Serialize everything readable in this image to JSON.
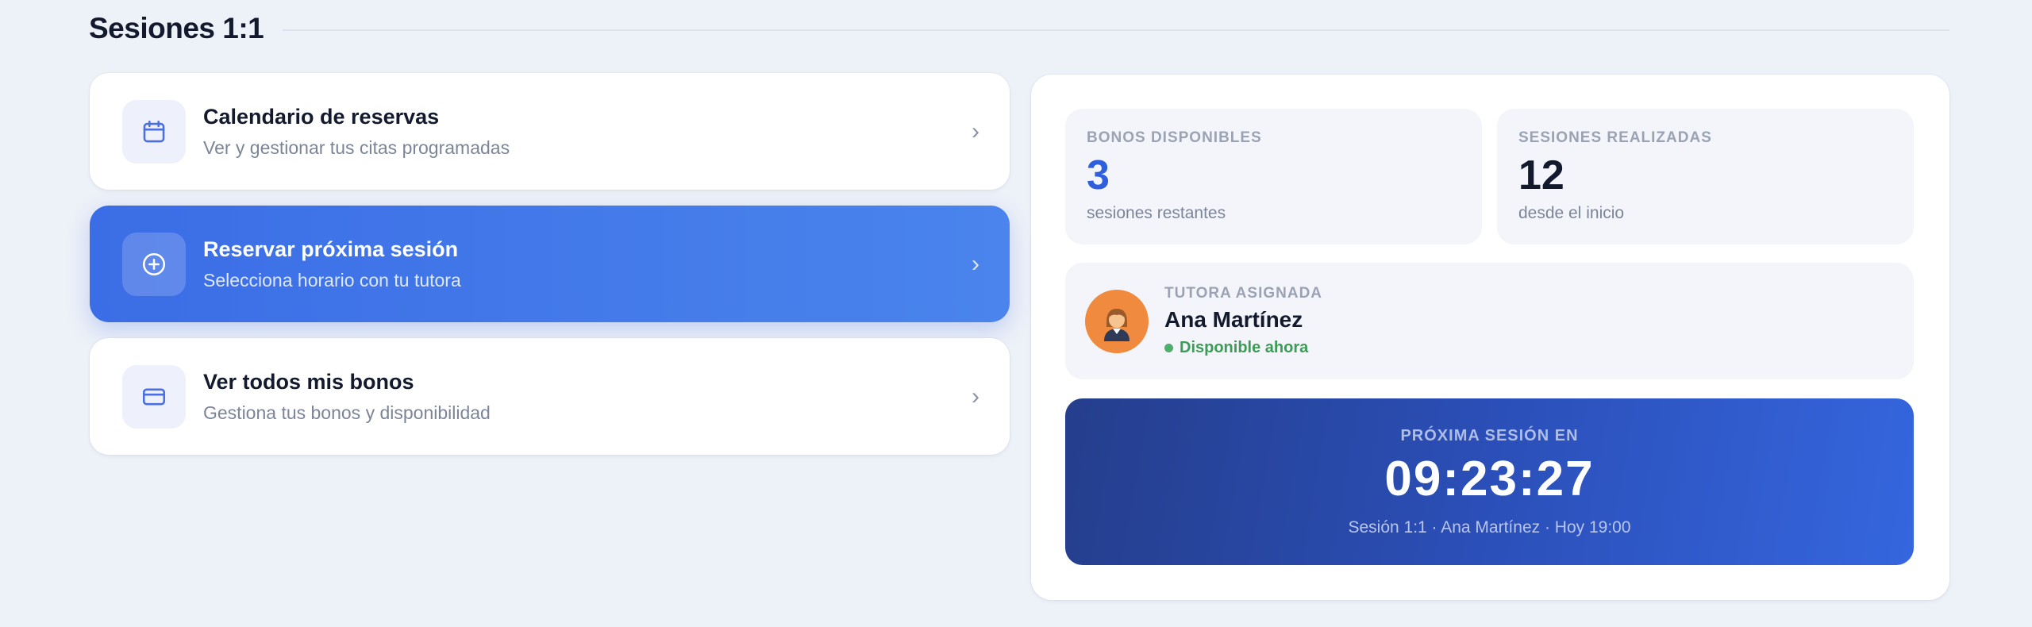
{
  "section": {
    "title": "Sesiones 1:1"
  },
  "actions": [
    {
      "icon": "calendar-icon",
      "title": "Calendario de reservas",
      "subtitle": "Ver y gestionar tus citas programadas"
    },
    {
      "icon": "plus-circle-icon",
      "title": "Reservar próxima sesión",
      "subtitle": "Selecciona horario con tu tutora"
    },
    {
      "icon": "credit-card-icon",
      "title": "Ver todos mis bonos",
      "subtitle": "Gestiona tus bonos y disponibilidad"
    }
  ],
  "chevron": "›",
  "stats": {
    "bonos": {
      "label": "BONOS DISPONIBLES",
      "value": "3",
      "sub": "sesiones restantes"
    },
    "sesiones": {
      "label": "SESIONES REALIZADAS",
      "value": "12",
      "sub": "desde el inicio"
    }
  },
  "tutor": {
    "label": "TUTORA ASIGNADA",
    "name": "Ana Martínez",
    "status": "Disponible ahora"
  },
  "countdown": {
    "label": "PRÓXIMA SESIÓN EN",
    "time": "09:23:27",
    "sub": "Sesión 1:1 · Ana Martínez · Hoy 19:00"
  },
  "colors": {
    "accent": "#3b6de6",
    "status_green": "#3e9a57",
    "avatar_bg": "#ef8a3f",
    "countdown_start": "#253e8c",
    "countdown_end": "#3566de"
  }
}
